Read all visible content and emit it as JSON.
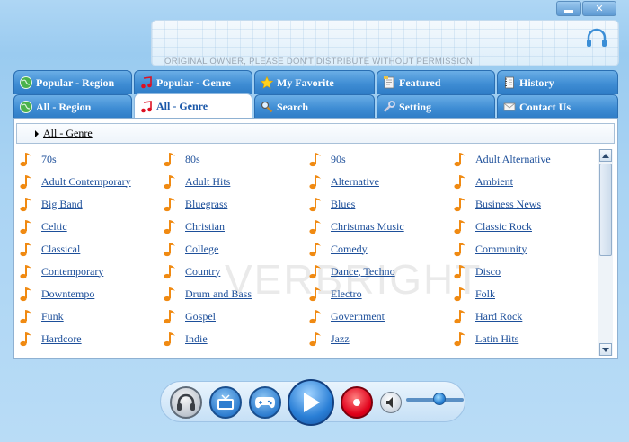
{
  "window": {
    "min_label": "",
    "close_label": "✕"
  },
  "banner": {
    "notice": "ORIGINAL OWNER, PLEASE DON'T DISTRIBUTE WITHOUT PERMISSION."
  },
  "tabs_row1": [
    {
      "label": "Popular - Region",
      "icon": "globe-icon"
    },
    {
      "label": "Popular - Genre",
      "icon": "music-note-icon"
    },
    {
      "label": "My Favorite",
      "icon": "star-icon"
    },
    {
      "label": "Featured",
      "icon": "document-icon"
    },
    {
      "label": "History",
      "icon": "notebook-icon"
    }
  ],
  "tabs_row2": [
    {
      "label": "All - Region",
      "icon": "globe-icon"
    },
    {
      "label": "All - Genre",
      "icon": "music-note-icon",
      "active": true
    },
    {
      "label": "Search",
      "icon": "search-icon"
    },
    {
      "label": "Setting",
      "icon": "wrench-icon"
    },
    {
      "label": "Contact Us",
      "icon": "mail-icon"
    }
  ],
  "breadcrumb": "All - Genre",
  "watermark": "VERBRIGHT",
  "genres": [
    "70s",
    "80s",
    "90s",
    "Adult Alternative",
    "Adult Contemporary",
    "Adult Hits",
    "Alternative",
    "Ambient",
    "Big Band",
    "Bluegrass",
    "Blues",
    "Business News",
    "Celtic",
    "Christian",
    "Christmas Music",
    "Classic Rock",
    "Classical",
    "College",
    "Comedy",
    "Community",
    "Contemporary",
    "Country",
    "Dance, Techno",
    "Disco",
    "Downtempo",
    "Drum and Bass",
    "Electro",
    "Folk",
    "Funk",
    "Gospel",
    "Government",
    "Hard Rock",
    "Hardcore",
    "Indie",
    "Jazz",
    "Latin Hits"
  ],
  "controls": [
    "headphones-button",
    "tv-button",
    "gamepad-button",
    "play-button",
    "record-button",
    "mute-button"
  ],
  "volume": {
    "level_percent": 60
  },
  "colors": {
    "accent": "#3f8dd4",
    "link": "#1d4f9a",
    "note": "#f08a12",
    "record": "#d6001c"
  }
}
